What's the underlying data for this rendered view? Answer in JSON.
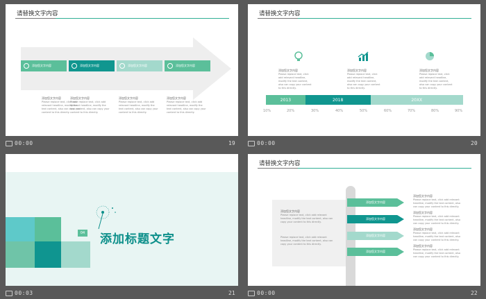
{
  "slides": [
    {
      "number": "19",
      "time": "00:00",
      "title": "请替换文字内容",
      "boxes": [
        {
          "label": "添加您文字内容",
          "color": "#5bbf9a"
        },
        {
          "label": "添加您文字内容",
          "color": "#10968f"
        },
        {
          "label": "添加您文字内容",
          "color": "#a3d9cc"
        },
        {
          "label": "添加您文字内容",
          "color": "#5bbf9a"
        }
      ],
      "columns": [
        {
          "heading": "添加您文字内容",
          "body": "Please replace text, click add relevant headline, modify the text content, also can copy your content to this directly."
        },
        {
          "heading": "添加您文字内容",
          "body": "Please replace text, click add relevant headline, modify the text content, also can copy your content to this directly."
        },
        {
          "heading": "添加您文字内容",
          "body": "Please replace text, click add relevant headline, modify the text content, also can copy your content to this directly."
        },
        {
          "heading": "添加您文字内容",
          "body": "Please replace text, click add relevant headline, modify the text content, also can copy your content to this directly."
        }
      ]
    },
    {
      "number": "20",
      "time": "00:00",
      "title": "请替换文字内容",
      "items": [
        {
          "heading": "添加您文字内容",
          "body": "Please replace text, click add relevant headline, modify the text content, also can copy your content to this directly."
        },
        {
          "heading": "添加您文字内容",
          "body": "Please replace text, click add relevant headline, modify the text content, also can copy your content to this directly."
        },
        {
          "heading": "添加您文字内容",
          "body": "Please replace text, click add relevant headline, modify the text content, also can copy your content to this directly."
        }
      ],
      "bars": [
        {
          "label": "2013",
          "start": 0,
          "end": 0.2,
          "color": "#5bbf9a"
        },
        {
          "label": "2018",
          "start": 0.2,
          "end": 0.53,
          "color": "#10968f"
        },
        {
          "label": "20XX",
          "start": 0.53,
          "end": 1.0,
          "color": "#a3d9cc"
        }
      ],
      "percent_labels": [
        "10%",
        "20%",
        "30%",
        "40%",
        "50%",
        "60%",
        "70%",
        "80%",
        "90%"
      ]
    },
    {
      "number": "21",
      "time": "00:03",
      "badge": "04",
      "title": "添加标题文字"
    },
    {
      "number": "22",
      "time": "00:00",
      "title": "请替换文字内容",
      "left_blocks": [
        {
          "heading": "添加您文字内容",
          "body": "Please replace text, click add relevant headline, modify the text content, also can copy your content to this directly."
        },
        {
          "body": "Please replace text, click add relevant headline, modify the text content, also can copy your content to this directly."
        }
      ],
      "flags": [
        {
          "label": "添加您文字内容",
          "color": "#5bbf9a"
        },
        {
          "label": "添加您文字内容",
          "color": "#10968f"
        },
        {
          "label": "添加您文字内容",
          "color": "#a3d9cc"
        },
        {
          "label": "添加您文字内容",
          "color": "#5bbf9a"
        }
      ],
      "right_blocks": [
        {
          "heading": "添加您文字内容",
          "body": "Please replace text, click add relevant headline, modify the text content, also can copy your content to this directly."
        },
        {
          "heading": "添加您文字内容",
          "body": "Please replace text, click add relevant headline, modify the text content, also can copy your content to this directly."
        },
        {
          "heading": "添加您文字内容",
          "body": "Please replace text, click add relevant headline, modify the text content, also can copy your content to this directly."
        },
        {
          "heading": "添加您文字内容",
          "body": "Please replace text, click add relevant headline, modify the text content, also can copy your content to this directly."
        }
      ]
    }
  ],
  "colors": {
    "accent": "#2fae94",
    "background": "#595959"
  }
}
